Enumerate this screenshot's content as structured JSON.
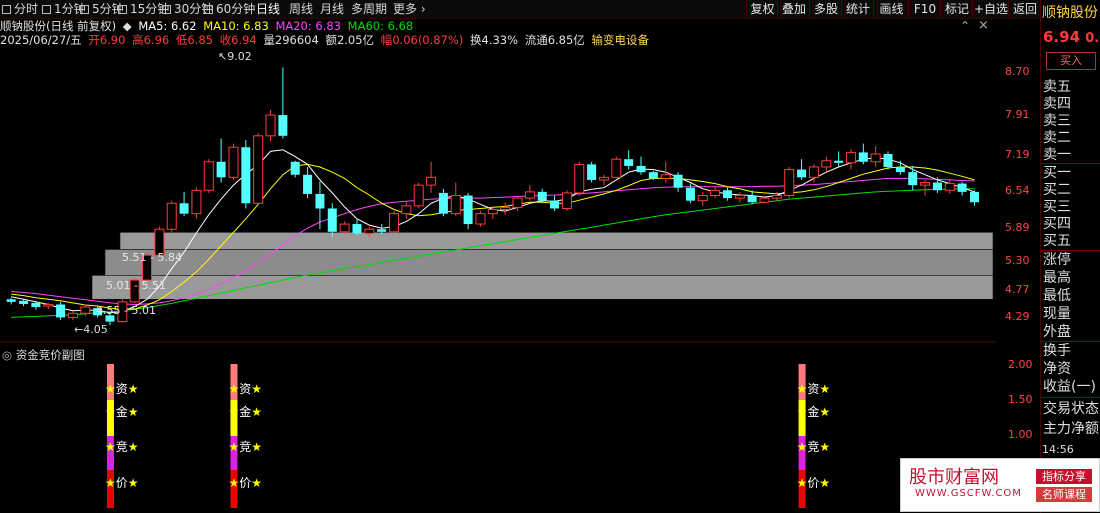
{
  "toolbar": {
    "tabs": [
      "分时",
      "1分钟",
      "5分钟",
      "15分钟",
      "30分钟",
      "60分钟",
      "日线",
      "周线",
      "月线",
      "多周期",
      "更多"
    ],
    "active_tab": "日线",
    "right_buttons": [
      "复权",
      "叠加",
      "多股",
      "统计",
      "画线",
      "F10",
      "标记",
      "+自选",
      "返回"
    ]
  },
  "header": {
    "title": "顺钠股份(日线 前复权)",
    "ma5": "MA5: 6.62",
    "ma10": "MA10: 6.83",
    "ma20": "MA20: 6.83",
    "ma60": "MA60: 6.68",
    "date": "2025/06/27/五",
    "open": "开6.90",
    "high": "高6.96",
    "low": "低6.85",
    "close": "收6.94",
    "volume": "量296604",
    "amount": "额2.05亿",
    "change": "幅0.06(0.87%)",
    "turnover": "换4.33%",
    "float": "流通6.85亿",
    "sector": "输变电设备"
  },
  "sidebar": {
    "name": "顺钠股份",
    "price": "6.94",
    "price_suffix": "0.",
    "buy_button": "买入",
    "rows": [
      "卖五",
      "卖四",
      "卖三",
      "卖二",
      "卖一",
      "买一",
      "买二",
      "买三",
      "买四",
      "买五",
      "涨停",
      "最高",
      "最低",
      "现量",
      "外盘",
      "换手",
      "净资",
      "收益(一)",
      "交易状态",
      "主力净额"
    ],
    "time": "14:56"
  },
  "axis": {
    "main_ticks": [
      "8.70",
      "7.91",
      "7.19",
      "6.54",
      "5.89",
      "5.30",
      "4.77",
      "4.29"
    ],
    "sub_ticks": [
      "2.00",
      "1.50",
      "1.00"
    ]
  },
  "annotations": {
    "high_label": "9.02",
    "low_label": "4.05",
    "zone1": "5.51 - 5.84",
    "zone2": "5.01 - 5.51",
    "zone3": "4.55 - 5.01"
  },
  "subchart": {
    "title": "资金竞价副图",
    "labels": [
      "资",
      "金",
      "竞",
      "价"
    ],
    "star": "★"
  },
  "watermark": {
    "site": "股市财富网",
    "url": "WWW.GSCFW.COM",
    "tag1": "指标分享",
    "tag2": "名师课程"
  },
  "colors": {
    "up": "#ff3b3b",
    "down": "#54ffff",
    "ma5": "#ffffff",
    "ma10": "#ffff00",
    "ma20": "#ff44ff",
    "ma60": "#00dd00"
  },
  "chart_data": {
    "type": "candlestick",
    "ylim": [
      3.9,
      9.2
    ],
    "candles": [
      [
        4.55,
        4.58,
        4.45,
        4.5
      ],
      [
        4.52,
        4.56,
        4.42,
        4.46
      ],
      [
        4.48,
        4.52,
        4.35,
        4.4
      ],
      [
        4.42,
        4.48,
        4.36,
        4.45
      ],
      [
        4.45,
        4.5,
        4.15,
        4.2
      ],
      [
        4.2,
        4.32,
        4.15,
        4.28
      ],
      [
        4.28,
        4.45,
        4.22,
        4.4
      ],
      [
        4.38,
        4.42,
        4.2,
        4.24
      ],
      [
        4.24,
        4.3,
        4.05,
        4.12
      ],
      [
        4.12,
        4.55,
        4.1,
        4.5
      ],
      [
        4.5,
        4.95,
        4.48,
        4.92
      ],
      [
        4.92,
        5.45,
        4.9,
        5.4
      ],
      [
        5.4,
        5.95,
        5.38,
        5.9
      ],
      [
        5.9,
        6.45,
        5.85,
        6.4
      ],
      [
        6.4,
        6.62,
        6.15,
        6.2
      ],
      [
        6.2,
        6.7,
        6.1,
        6.65
      ],
      [
        6.65,
        7.25,
        6.6,
        7.2
      ],
      [
        7.2,
        7.65,
        6.8,
        6.9
      ],
      [
        6.9,
        7.55,
        6.85,
        7.48
      ],
      [
        7.48,
        7.62,
        6.3,
        6.4
      ],
      [
        6.4,
        7.75,
        6.38,
        7.7
      ],
      [
        7.7,
        8.2,
        7.6,
        8.1
      ],
      [
        8.1,
        9.02,
        7.65,
        7.7
      ],
      [
        7.2,
        7.22,
        6.9,
        6.95
      ],
      [
        6.95,
        7.1,
        6.5,
        6.58
      ],
      [
        6.58,
        6.82,
        5.9,
        6.3
      ],
      [
        6.3,
        6.4,
        5.75,
        5.85
      ],
      [
        5.85,
        6.05,
        5.8,
        6.0
      ],
      [
        6.0,
        6.1,
        5.78,
        5.82
      ],
      [
        5.82,
        5.95,
        5.75,
        5.9
      ],
      [
        5.9,
        6.0,
        5.8,
        5.85
      ],
      [
        5.85,
        6.25,
        5.83,
        6.2
      ],
      [
        6.2,
        6.42,
        6.1,
        6.35
      ],
      [
        6.35,
        6.8,
        6.3,
        6.75
      ],
      [
        6.75,
        7.2,
        6.6,
        6.9
      ],
      [
        6.6,
        6.68,
        6.15,
        6.2
      ],
      [
        6.2,
        6.8,
        6.15,
        6.55
      ],
      [
        6.55,
        6.6,
        5.9,
        6.0
      ],
      [
        6.0,
        6.25,
        5.95,
        6.2
      ],
      [
        6.2,
        6.35,
        6.1,
        6.28
      ],
      [
        6.28,
        6.42,
        6.18,
        6.32
      ],
      [
        6.32,
        6.55,
        6.25,
        6.5
      ],
      [
        6.5,
        6.75,
        6.45,
        6.62
      ],
      [
        6.62,
        6.68,
        6.4,
        6.45
      ],
      [
        6.45,
        6.55,
        6.25,
        6.3
      ],
      [
        6.3,
        6.65,
        6.25,
        6.6
      ],
      [
        6.6,
        7.2,
        6.55,
        7.15
      ],
      [
        7.15,
        7.2,
        6.8,
        6.85
      ],
      [
        6.85,
        6.95,
        6.75,
        6.9
      ],
      [
        6.9,
        7.3,
        6.88,
        7.25
      ],
      [
        7.25,
        7.42,
        7.05,
        7.12
      ],
      [
        7.12,
        7.3,
        6.95,
        7.0
      ],
      [
        7.0,
        7.02,
        6.85,
        6.88
      ],
      [
        6.88,
        7.2,
        6.8,
        6.95
      ],
      [
        6.95,
        7.0,
        6.62,
        6.7
      ],
      [
        6.7,
        6.78,
        6.4,
        6.45
      ],
      [
        6.45,
        6.62,
        6.35,
        6.55
      ],
      [
        6.55,
        6.72,
        6.5,
        6.65
      ],
      [
        6.65,
        6.7,
        6.45,
        6.5
      ],
      [
        6.5,
        6.62,
        6.42,
        6.55
      ],
      [
        6.55,
        6.65,
        6.38,
        6.42
      ],
      [
        6.42,
        6.55,
        6.4,
        6.5
      ],
      [
        6.5,
        6.62,
        6.45,
        6.55
      ],
      [
        6.55,
        7.1,
        6.5,
        7.05
      ],
      [
        7.05,
        7.25,
        6.85,
        6.9
      ],
      [
        6.9,
        7.15,
        6.8,
        7.1
      ],
      [
        7.1,
        7.3,
        7.0,
        7.22
      ],
      [
        7.22,
        7.4,
        7.1,
        7.18
      ],
      [
        7.18,
        7.45,
        7.05,
        7.38
      ],
      [
        7.38,
        7.55,
        7.15,
        7.2
      ],
      [
        7.2,
        7.5,
        7.1,
        7.35
      ],
      [
        7.35,
        7.4,
        7.05,
        7.1
      ],
      [
        7.1,
        7.22,
        6.95,
        7.0
      ],
      [
        7.0,
        7.12,
        6.65,
        6.75
      ],
      [
        6.75,
        6.85,
        6.55,
        6.8
      ],
      [
        6.8,
        6.9,
        6.6,
        6.65
      ],
      [
        6.65,
        6.88,
        6.58,
        6.78
      ],
      [
        6.78,
        6.82,
        6.55,
        6.62
      ],
      [
        6.62,
        6.65,
        6.35,
        6.42
      ]
    ],
    "ma5": [
      4.6,
      4.55,
      4.5,
      4.45,
      4.38,
      4.33,
      4.34,
      4.34,
      4.29,
      4.31,
      4.41,
      4.55,
      4.8,
      5.14,
      5.46,
      5.83,
      6.18,
      6.48,
      6.75,
      6.96,
      7.14,
      7.4,
      7.43,
      7.3,
      7.15,
      6.85,
      6.6,
      6.33,
      6.1,
      5.98,
      5.92,
      5.95,
      6.05,
      6.2,
      6.4,
      6.5,
      6.55,
      6.48,
      6.38,
      6.28,
      6.25,
      6.32,
      6.4,
      6.45,
      6.44,
      6.48,
      6.62,
      6.67,
      6.7,
      6.85,
      7.0,
      7.06,
      7.05,
      7.0,
      6.9,
      6.8,
      6.68,
      6.62,
      6.58,
      6.56,
      6.55,
      6.52,
      6.55,
      6.65,
      6.75,
      6.88,
      7.0,
      7.1,
      7.18,
      7.25,
      7.28,
      7.25,
      7.18,
      7.05,
      6.95,
      6.85,
      6.78,
      6.7,
      6.62
    ],
    "ma10": [
      4.65,
      4.62,
      4.58,
      4.55,
      4.52,
      4.48,
      4.44,
      4.42,
      4.38,
      4.36,
      4.36,
      4.44,
      4.54,
      4.7,
      4.88,
      5.08,
      5.32,
      5.58,
      5.84,
      6.1,
      6.38,
      6.68,
      6.95,
      7.12,
      7.15,
      7.1,
      7.0,
      6.88,
      6.7,
      6.56,
      6.4,
      6.28,
      6.2,
      6.16,
      6.18,
      6.22,
      6.26,
      6.28,
      6.3,
      6.32,
      6.34,
      6.38,
      6.42,
      6.42,
      6.4,
      6.4,
      6.46,
      6.52,
      6.58,
      6.65,
      6.74,
      6.84,
      6.88,
      6.88,
      6.88,
      6.85,
      6.82,
      6.78,
      6.72,
      6.68,
      6.62,
      6.6,
      6.58,
      6.6,
      6.62,
      6.66,
      6.72,
      6.8,
      6.88,
      6.96,
      7.02,
      7.08,
      7.1,
      7.1,
      7.08,
      7.04,
      6.98,
      6.92,
      6.85
    ],
    "ma20": [
      4.7,
      4.68,
      4.66,
      4.63,
      4.6,
      4.57,
      4.54,
      4.51,
      4.48,
      4.46,
      4.45,
      4.46,
      4.48,
      4.52,
      4.58,
      4.65,
      4.74,
      4.85,
      4.97,
      5.1,
      5.25,
      5.42,
      5.6,
      5.78,
      5.92,
      6.04,
      6.12,
      6.2,
      6.28,
      6.34,
      6.39,
      6.42,
      6.44,
      6.46,
      6.48,
      6.49,
      6.5,
      6.5,
      6.5,
      6.51,
      6.52,
      6.53,
      6.54,
      6.55,
      6.56,
      6.57,
      6.58,
      6.6,
      6.62,
      6.64,
      6.66,
      6.68,
      6.7,
      6.71,
      6.72,
      6.72,
      6.72,
      6.72,
      6.72,
      6.72,
      6.72,
      6.73,
      6.73,
      6.74,
      6.75,
      6.76,
      6.78,
      6.8,
      6.82,
      6.84,
      6.86,
      6.88,
      6.88,
      6.88,
      6.87,
      6.86,
      6.85,
      6.84,
      6.83
    ],
    "ma60": [
      4.2,
      4.21,
      4.22,
      4.23,
      4.24,
      4.25,
      4.27,
      4.29,
      4.31,
      4.33,
      4.36,
      4.39,
      4.43,
      4.47,
      4.52,
      4.57,
      4.62,
      4.67,
      4.72,
      4.77,
      4.82,
      4.87,
      4.92,
      4.97,
      5.02,
      5.06,
      5.1,
      5.14,
      5.18,
      5.22,
      5.26,
      5.3,
      5.34,
      5.38,
      5.42,
      5.46,
      5.5,
      5.54,
      5.58,
      5.62,
      5.66,
      5.7,
      5.74,
      5.78,
      5.82,
      5.86,
      5.9,
      5.94,
      5.98,
      6.02,
      6.06,
      6.1,
      6.14,
      6.18,
      6.21,
      6.24,
      6.27,
      6.3,
      6.33,
      6.36,
      6.39,
      6.42,
      6.45,
      6.48,
      6.5,
      6.52,
      6.54,
      6.56,
      6.58,
      6.6,
      6.62,
      6.63,
      6.64,
      6.65,
      6.66,
      6.67,
      6.67,
      6.68,
      6.68
    ],
    "zones": [
      {
        "label": "5.51 - 5.84",
        "low": 5.51,
        "high": 5.84
      },
      {
        "label": "5.01 - 5.51",
        "low": 5.01,
        "high": 5.51
      },
      {
        "label": "4.55 - 5.01",
        "low": 4.55,
        "high": 5.01
      }
    ],
    "signal_bars": [
      {
        "index": 8
      },
      {
        "index": 18
      },
      {
        "index": 64
      }
    ],
    "sub_ylim": [
      0.5,
      2.2
    ]
  }
}
